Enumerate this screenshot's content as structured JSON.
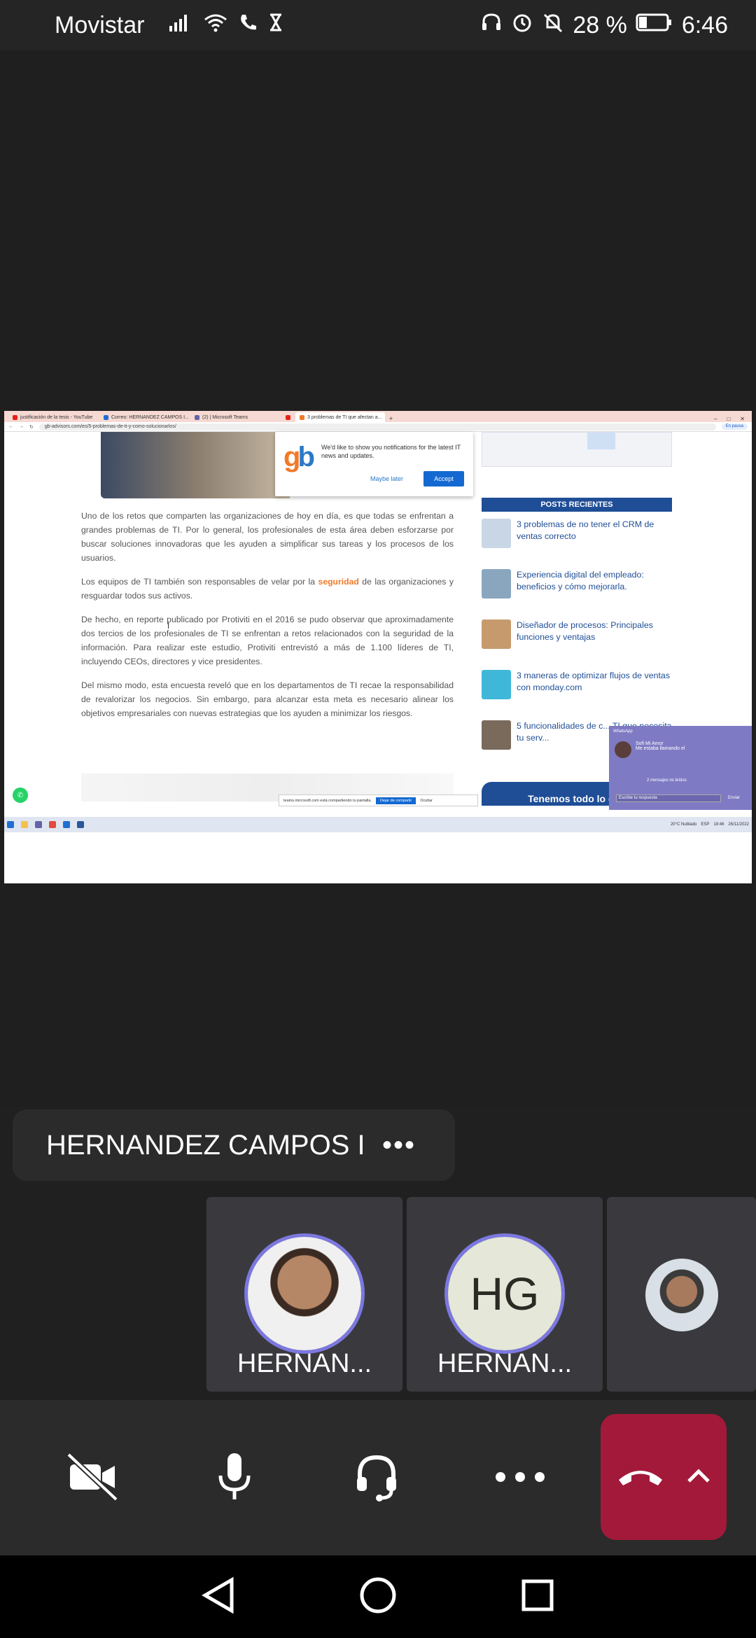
{
  "status": {
    "carrier": "Movistar",
    "battery": "28 %",
    "time": "6:46"
  },
  "shared_screen": {
    "tabs": [
      {
        "label": "justificación de la tesis - YouTube",
        "color": "#e62117"
      },
      {
        "label": "Correo: HERNANDEZ CAMPOS I...",
        "color": "#1f6fd1"
      },
      {
        "label": "(2) | Microsoft Teams",
        "color": "#6264a7"
      },
      {
        "label": "",
        "color": "#e62117"
      },
      {
        "label": "3 problemas de TI que afectan a...",
        "color": "#f07a2a"
      }
    ],
    "url": "gb-advisors.com/es/5-problemas-de-ti-y-como-solucionarlos/",
    "profile_label": "En pausa",
    "notification": {
      "text": "We'd like to show you notifications for the latest IT news and updates.",
      "maybe_later": "Maybe later",
      "accept": "Accept"
    },
    "article": {
      "p1": "Uno de los retos que comparten las organizaciones de hoy en día, es que todas se enfrentan a grandes problemas de TI. Por lo general, los profesionales de esta área deben esforzarse por buscar soluciones innovadoras que les ayuden a simplificar sus tareas y los procesos de los usuarios.",
      "p2_before": "Los equipos de TI también son responsables de velar por la ",
      "p2_highlight": "seguridad",
      "p2_after": " de las organizaciones y resguardar todos sus activos.",
      "p3": "De hecho, en reporte publicado por Protiviti en el 2016 se pudo observar que aproximadamente dos tercios de los profesionales de TI se enfrentan a retos relacionados con la seguridad de la información. Para realizar este estudio, Protiviti entrevistó a más de 1.100 líderes de TI, incluyendo CEOs, directores y vice presidentes.",
      "p4": "Del mismo modo, esta encuesta reveló que en los departamentos de TI recae la responsabilidad de revalorizar los negocios. Sin embargo, para alcanzar esta meta es necesario alinear los objetivos empresariales con nuevas estrategias que los ayuden a minimizar los riesgos."
    },
    "recent_posts_title": "POSTS RECIENTES",
    "recent_posts": [
      {
        "title": "3 problemas de no tener el CRM de ventas correcto",
        "thumb": "#c9d6e6"
      },
      {
        "title": "Experiencia digital del empleado: beneficios y cómo mejorarla.",
        "thumb": "#8aa6bf"
      },
      {
        "title": "Diseñador de procesos: Principales funciones y ventajas",
        "thumb": "#c79a6e"
      },
      {
        "title": "3 maneras de optimizar flujos de ventas con monday.com",
        "thumb": "#3fb7d8"
      },
      {
        "title": "5 funcionalidades de c... TI que necesita tu serv...",
        "thumb": "#7a6a5c"
      }
    ],
    "banner": "Tenemos todo lo que",
    "share_bar": {
      "text": "teams.microsoft.com está compartiendo tu pantalla.",
      "stop": "Dejar de compartir",
      "hide": "Ocultar"
    },
    "whatsapp_popup": {
      "app": "WhatsApp",
      "contact": "Sofi Mi Amor",
      "message": "Me estaba llamando el",
      "unread": "2 mensajes no leídos",
      "reply_placeholder": "Escribe tu respuesta",
      "send": "Enviar"
    },
    "taskbar": {
      "weather": "20°C  Nublado",
      "lang": "ESP",
      "clock": "18:46",
      "date": "26/11/2022"
    }
  },
  "call": {
    "presenter_name": "HERNANDEZ CAMPOS I",
    "participants": [
      {
        "name": "HERNAN...",
        "initials": ""
      },
      {
        "name": "HERNAN...",
        "initials": "HG"
      }
    ]
  }
}
